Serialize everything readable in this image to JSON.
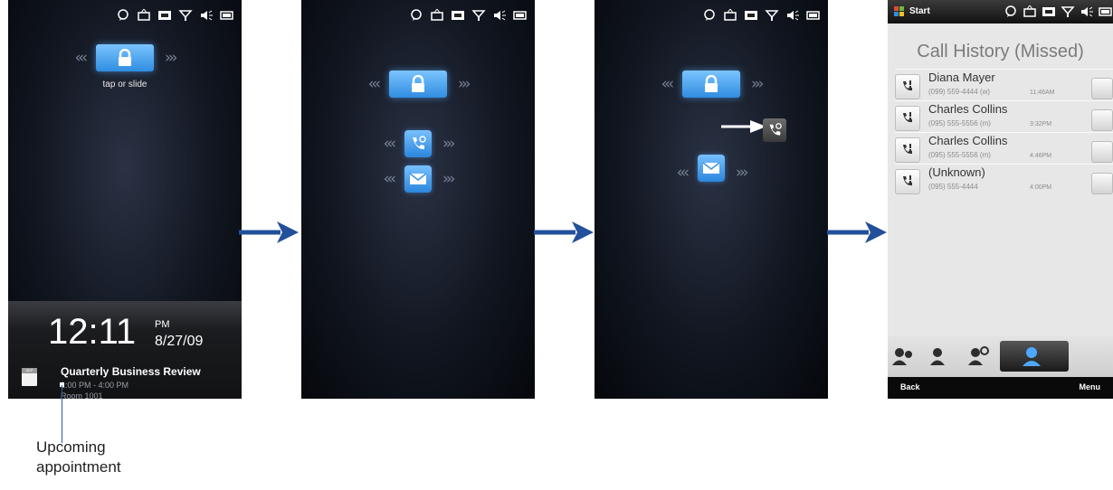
{
  "screens": {
    "locked": {
      "hint": "tap or slide",
      "clock": "12:11",
      "ampm": "PM",
      "date": "8/27/09",
      "appointment": {
        "title": "Quarterly Business Review",
        "time": "1:00 PM - 4:00 PM",
        "location": "Room 1001",
        "calendar_icon_text": "SEP"
      }
    },
    "call_history": {
      "start_label": "Start",
      "title": "Call History (Missed)",
      "calls": [
        {
          "name": "Diana Mayer",
          "number": "(099) 559-4444 (w)",
          "time": "11:46AM"
        },
        {
          "name": "Charles Collins",
          "number": "(095) 555-5556 (m)",
          "time": "3:32PM"
        },
        {
          "name": "Charles Collins",
          "number": "(095) 555-5556 (m)",
          "time": "4:46PM"
        },
        {
          "name": "(Unknown)",
          "number": "(095) 555-4444",
          "time": "4:00PM"
        }
      ],
      "left_softkey": "Back",
      "right_softkey": "Menu"
    }
  },
  "annotation": {
    "callout_line1": "Upcoming",
    "callout_line2": "appointment"
  },
  "colors": {
    "flow_arrow": "#22509a",
    "lock_blue": "#3d94e5"
  }
}
